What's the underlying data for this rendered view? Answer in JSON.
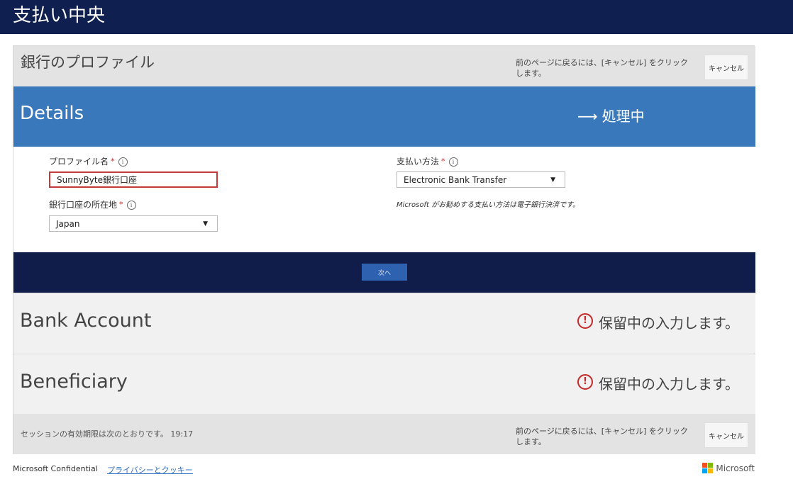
{
  "topbar": {
    "title": "支払い中央"
  },
  "header": {
    "title": "銀行のプロファイル",
    "hint": "前のページに戻るには、[キャンセル] をクリックします。",
    "cancel_label": "キャンセル"
  },
  "details": {
    "title": "Details",
    "status_arrow": "⟶",
    "status_text": "処理中"
  },
  "form": {
    "profile_name_label": "プロファイル名",
    "profile_name_value": "SunnyByte銀行口座",
    "bank_location_label": "銀行口座の所在地",
    "bank_location_value": "Japan",
    "payment_method_label": "支払い方法",
    "payment_method_value": "Electronic Bank Transfer",
    "payment_method_note": "Microsoft がお勧めする支払い方法は電子銀行決済です。",
    "required_mark": "*",
    "info_symbol": "i",
    "caret": "▼"
  },
  "next": {
    "label": "次へ"
  },
  "sections": [
    {
      "title": "Bank Account",
      "status": "保留中の入力します。"
    },
    {
      "title": "Beneficiary",
      "status": "保留中の入力します。"
    }
  ],
  "footer": {
    "session_text": "セッションの有効期限は次のとおりです。 19:17",
    "hint": "前のページに戻るには、[キャンセル] をクリックします。",
    "cancel_label": "キャンセル"
  },
  "page_footer": {
    "confidential": "Microsoft Confidential",
    "privacy_link": "プライバシーとクッキー",
    "brand": "Microsoft"
  },
  "colors": {
    "topbar": "#0f1f4f",
    "details_band": "#3a78bc",
    "next_band": "#101d4b",
    "next_button": "#2e62b1",
    "error_border": "#c43b3b",
    "alert_red": "#c62828",
    "ms_red": "#f25022",
    "ms_green": "#7fba00",
    "ms_blue": "#00a4ef",
    "ms_yellow": "#ffb900"
  }
}
